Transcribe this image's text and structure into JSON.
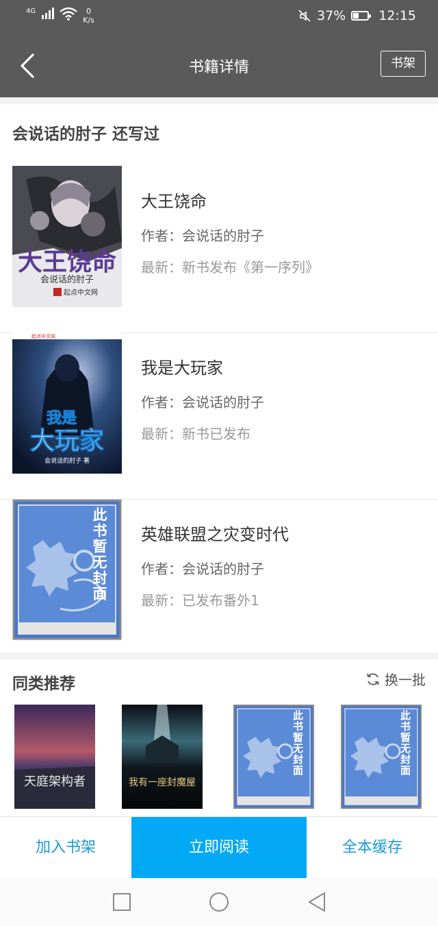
{
  "status_bar": {
    "network": "4G",
    "speed_value": "0",
    "speed_unit": "K/s",
    "battery": "37%",
    "time": "12:15",
    "icons": [
      "signal-icon",
      "wifi-icon",
      "mute-icon",
      "battery-icon"
    ]
  },
  "header": {
    "title": "书籍详情",
    "shelf_button": "书架",
    "back_icon": "back-arrow-icon"
  },
  "author_section": {
    "title": "会说话的肘子  还写过",
    "books": [
      {
        "title": "大王饶命",
        "author": "作者：会说话的肘子",
        "latest": "最新：新书发布《第一序列》"
      },
      {
        "title": "我是大玩家",
        "author": "作者：会说话的肘子",
        "latest": "最新：新书已发布"
      },
      {
        "title": "英雄联盟之灾变时代",
        "author": "作者：会说话的肘子",
        "latest": "最新：已发布番外1"
      }
    ],
    "cover_texts": {
      "book1_title": "大王饶命",
      "book1_author": "会说话的肘子",
      "book1_site": "起点中文网",
      "book2_site": "起点中文网",
      "book2_title_a": "我是",
      "book2_title_b": "大玩家",
      "book2_author": "会说话的肘子 著",
      "placeholder": "此书暂无封面"
    }
  },
  "recommend_section": {
    "title": "同类推荐",
    "refresh_label": "换一批",
    "cover_texts": {
      "rec1_title": "天庭架构者",
      "rec2_title": "我有一座封魔屋",
      "placeholder": "此书暂无封面"
    }
  },
  "bottom_bar": {
    "add_shelf": "加入书架",
    "read_now": "立即阅读",
    "cache_all": "全本缓存"
  },
  "colors": {
    "header_bg": "#5a5a5a",
    "accent_blue": "#03a9f4",
    "link_blue": "#1e9ad6"
  }
}
